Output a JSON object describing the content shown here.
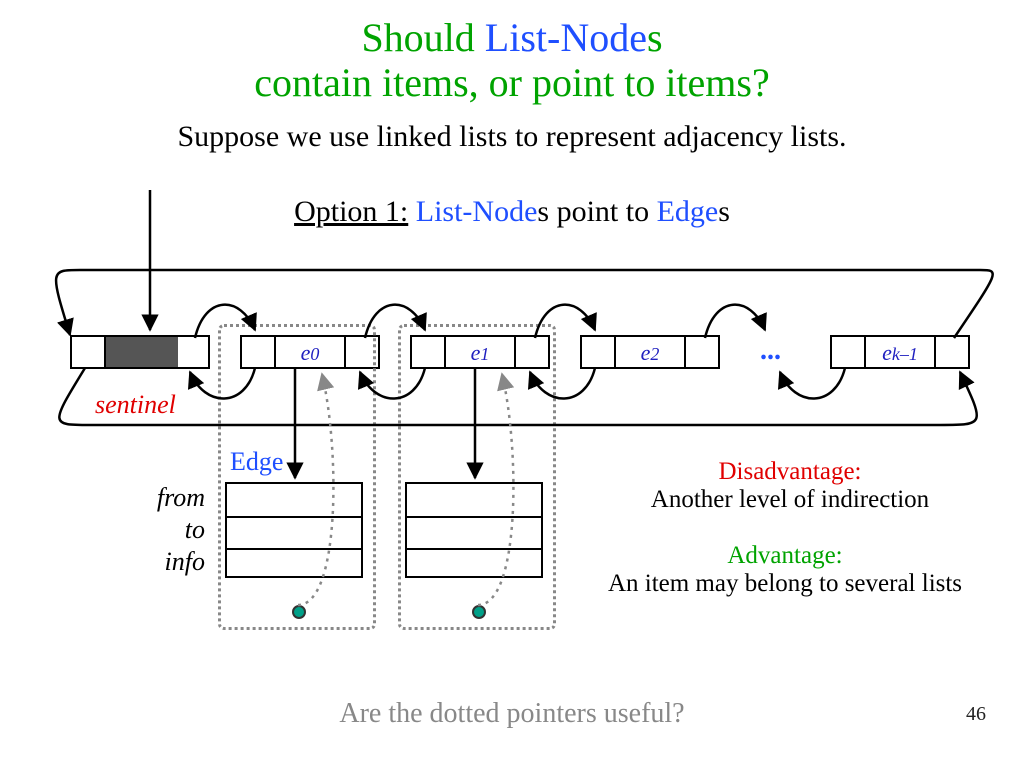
{
  "title": {
    "w1_green": "Should ",
    "w2_blue": "List-Node",
    "w3_green": "s",
    "line2_green": "contain items, or point to items?"
  },
  "subtitle": "Suppose we use linked lists to represent adjacency lists.",
  "option": {
    "prefix": "Option 1:",
    "a_blue": " List-Node",
    "a_black": "s",
    "mid": " point to ",
    "b_blue": "Edge",
    "b_black": "s"
  },
  "diagram": {
    "sentinel_label": "sentinel",
    "edge_label": "Edge",
    "field_labels": [
      "from",
      "to",
      "info"
    ],
    "dots_label": "...",
    "nodes": [
      {
        "label": null,
        "sentinel": true
      },
      {
        "label_base": "e",
        "label_sub": "0"
      },
      {
        "label_base": "e",
        "label_sub": "1"
      },
      {
        "label_base": "e",
        "label_sub": "2"
      },
      {
        "label_base": "e",
        "label_sub_it": "k–1"
      }
    ]
  },
  "disadvantage": {
    "heading": "Disadvantage:",
    "text": "Another level of indirection"
  },
  "advantage": {
    "heading": "Advantage:",
    "text": "An item may belong to several lists"
  },
  "footer_question": "Are the dotted pointers useful?",
  "page_number": "46"
}
